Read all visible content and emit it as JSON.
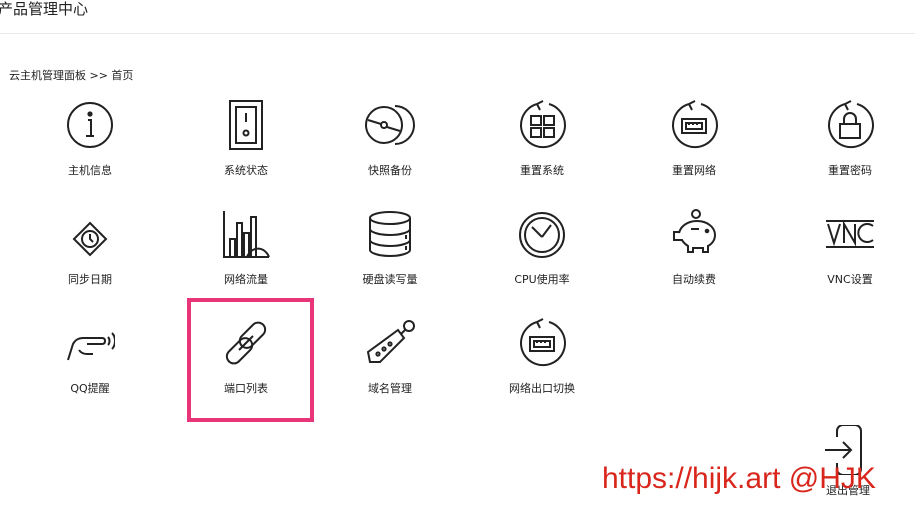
{
  "header": {
    "title": "产品管理中心"
  },
  "breadcrumb": {
    "text": "云主机管理面板 >> 首页"
  },
  "tiles": [
    {
      "label": "主机信息",
      "icon": "info-icon"
    },
    {
      "label": "系统状态",
      "icon": "power-switch-icon"
    },
    {
      "label": "快照备份",
      "icon": "disc-icon"
    },
    {
      "label": "重置系统",
      "icon": "reset-windows-icon"
    },
    {
      "label": "重置网络",
      "icon": "reset-network-icon"
    },
    {
      "label": "重置密码",
      "icon": "reset-password-icon"
    },
    {
      "label": "同步日期",
      "icon": "sync-clock-icon"
    },
    {
      "label": "网络流量",
      "icon": "bar-chart-icon"
    },
    {
      "label": "硬盘读写量",
      "icon": "database-icon"
    },
    {
      "label": "CPU使用率",
      "icon": "gauge-icon"
    },
    {
      "label": "自动续费",
      "icon": "piggy-bank-icon"
    },
    {
      "label": "VNC设置",
      "icon": "vnc-icon"
    },
    {
      "label": "QQ提醒",
      "icon": "hand-pointer-icon"
    },
    {
      "label": "端口列表",
      "icon": "chain-link-icon"
    },
    {
      "label": "域名管理",
      "icon": "price-tag-icon"
    },
    {
      "label": "网络出口切换",
      "icon": "network-switch-icon"
    }
  ],
  "logout": {
    "label": "退出管理",
    "icon": "logout-icon"
  },
  "watermark": {
    "text": "https://hijk.art @HJK"
  },
  "colors": {
    "highlight": "#e8357a",
    "watermark": "#d9261c"
  }
}
